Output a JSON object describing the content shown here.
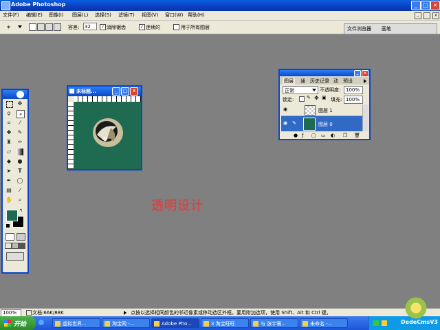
{
  "app": {
    "title": "Adobe Photoshop"
  },
  "menu": [
    "文件(F)",
    "编辑(E)",
    "图像(I)",
    "图层(L)",
    "选择(S)",
    "滤镜(T)",
    "视图(V)",
    "窗口(W)",
    "帮助(H)"
  ],
  "options": {
    "tolerance_label": "容差:",
    "tolerance_value": "32",
    "antialias_label": "消除锯齿",
    "contiguous_label": "连续的",
    "all_layers_label": "用于所有图层",
    "tabs": [
      "文件浏览器",
      "画笔"
    ]
  },
  "doc_window": {
    "title": "未标题..."
  },
  "layers_panel": {
    "tabs": [
      "图层",
      "通",
      "历史记录",
      "动",
      "预设"
    ],
    "blend_mode": "正常",
    "opacity_label": "不透明度:",
    "opacity_value": "100%",
    "lock_label": "锁定:",
    "fill_label": "填充:",
    "fill_value": "100%",
    "layers": [
      {
        "name": "图层 1",
        "selected": false
      },
      {
        "name": "图层 0",
        "selected": true
      }
    ]
  },
  "watermark_text": "透明设计",
  "status": {
    "zoom": "100%",
    "doc_size": "文档:66K/88K",
    "hint": "点按以选择相同颜色的邻近像素或移动选区外框。要用附加选项，使用 Shift、Alt 和 Ctrl 键。"
  },
  "taskbar": {
    "start": "开始",
    "items": [
      "虚拟世界...",
      "淘宝网 -...",
      "Adobe Pho...",
      "3 淘宝旺旺",
      "与 张宇寰...",
      "未命名 -..."
    ],
    "clock": "DedeCmsV3"
  },
  "colors": {
    "canvas": "#1e6b52",
    "workspace": "#808080",
    "foreground": "#1e6b52",
    "accent": "#0a47c8"
  }
}
